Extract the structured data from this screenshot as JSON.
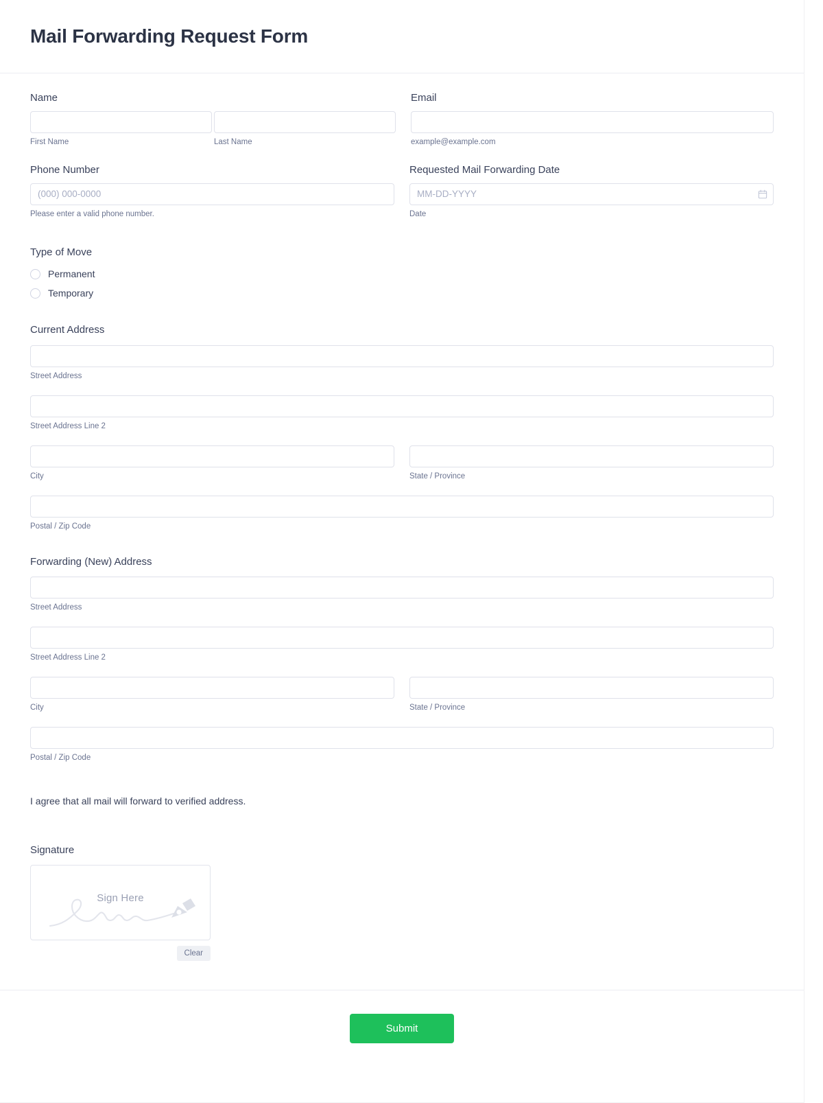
{
  "header": {
    "title": "Mail Forwarding Request Form"
  },
  "fields": {
    "name": {
      "label": "Name",
      "first": {
        "sub_label": "First Name",
        "value": "",
        "placeholder": ""
      },
      "last": {
        "sub_label": "Last Name",
        "value": "",
        "placeholder": ""
      }
    },
    "email": {
      "label": "Email",
      "sub_label": "example@example.com",
      "value": "",
      "placeholder": ""
    },
    "phone": {
      "label": "Phone Number",
      "placeholder": "(000) 000-0000",
      "sub_label": "Please enter a valid phone number.",
      "value": ""
    },
    "date": {
      "label": "Requested Mail Forwarding Date",
      "placeholder": "MM-DD-YYYY",
      "sub_label": "Date",
      "value": "",
      "icon": "calendar-icon"
    },
    "type_of_move": {
      "label": "Type of Move",
      "options": [
        {
          "label": "Permanent",
          "selected": false
        },
        {
          "label": "Temporary",
          "selected": false
        }
      ]
    },
    "current_address": {
      "label": "Current Address",
      "street": {
        "sub_label": "Street Address",
        "value": ""
      },
      "street2": {
        "sub_label": "Street Address Line 2",
        "value": ""
      },
      "city": {
        "sub_label": "City",
        "value": ""
      },
      "state": {
        "sub_label": "State / Province",
        "value": ""
      },
      "postal": {
        "sub_label": "Postal / Zip Code",
        "value": ""
      }
    },
    "forwarding_address": {
      "label": "Forwarding (New) Address",
      "street": {
        "sub_label": "Street Address",
        "value": ""
      },
      "street2": {
        "sub_label": "Street Address Line 2",
        "value": ""
      },
      "city": {
        "sub_label": "City",
        "value": ""
      },
      "state": {
        "sub_label": "State / Province",
        "value": ""
      },
      "postal": {
        "sub_label": "Postal / Zip Code",
        "value": ""
      }
    },
    "agreement": {
      "text": "I agree that all mail will forward to verified address."
    },
    "signature": {
      "label": "Signature",
      "placeholder_text": "Sign Here",
      "clear_label": "Clear",
      "pen_icon": "pen-nib-icon"
    }
  },
  "footer": {
    "submit_label": "Submit"
  },
  "colors": {
    "accent_green": "#1ec05b",
    "title_text": "#2c3345",
    "label_text": "#39415a",
    "sub_label_text": "#6a7390",
    "input_border": "#dfe1ea",
    "placeholder_text": "#a8aec4",
    "divider": "#ecedf2"
  }
}
